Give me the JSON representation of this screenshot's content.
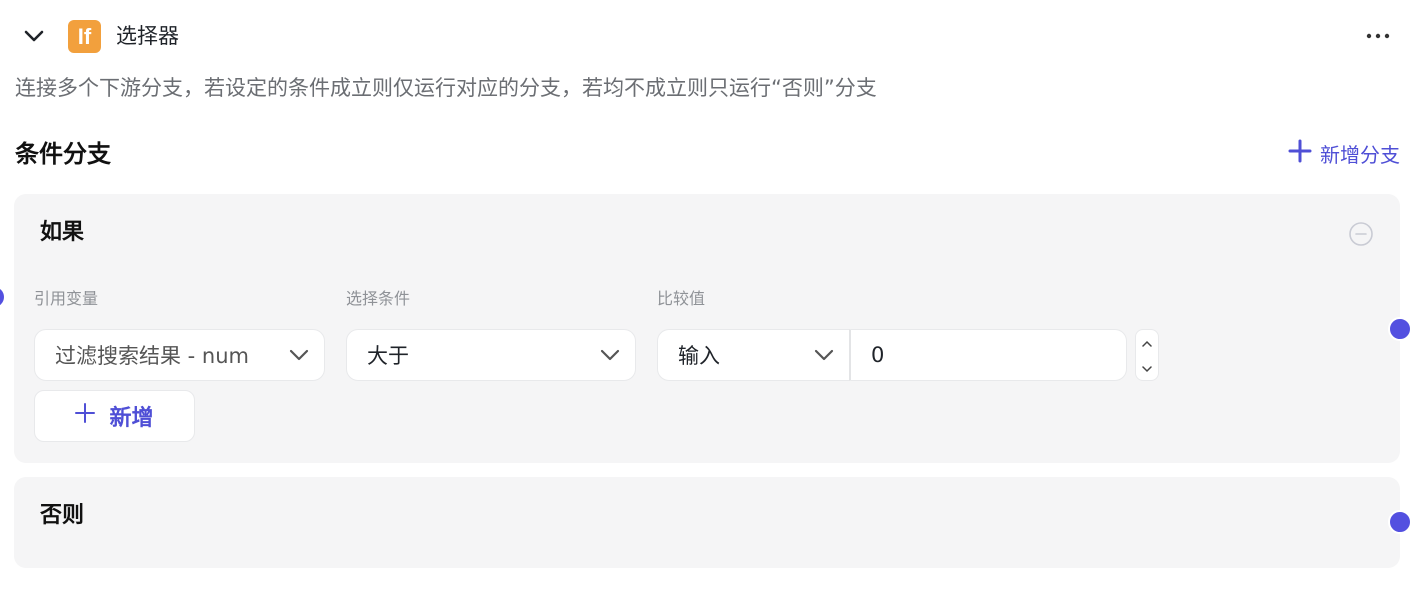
{
  "node": {
    "icon_text": "If",
    "icon_color": "#f2a03d",
    "title": "选择器",
    "description": "连接多个下游分支，若设定的条件成立则仅运行对应的分支，若均不成立则只运行“否则”分支"
  },
  "branches": {
    "section_title": "条件分支",
    "add_branch_label": "新增分支",
    "accent_color": "#4f4fd6"
  },
  "if_card": {
    "title": "如果",
    "labels": {
      "variable": "引用变量",
      "condition": "选择条件",
      "compare": "比较值"
    },
    "variable_value": "过滤搜索结果 - num",
    "condition_value": "大于",
    "compare_type": "输入",
    "compare_value": "0",
    "add_condition_label": "新增"
  },
  "else_card": {
    "title": "否则"
  }
}
